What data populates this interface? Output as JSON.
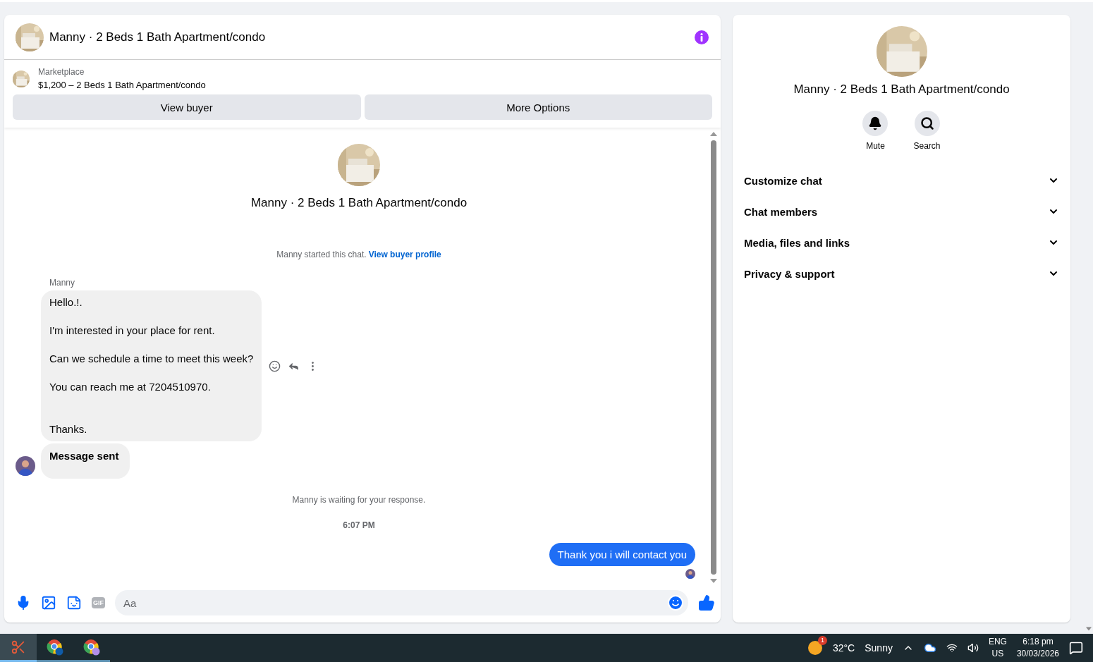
{
  "chat": {
    "title": "Manny · 2 Beds 1 Bath Apartment/condo",
    "listing": {
      "source": "Marketplace",
      "summary": "$1,200 – 2 Beds 1 Bath Apartment/condo"
    },
    "actions": [
      "View buyer",
      "More Options"
    ],
    "intro": {
      "name": "Manny · 2 Beds 1 Bath Apartment/condo"
    },
    "timeline": [
      {
        "kind": "system",
        "text": "Manny started this chat.",
        "link": "View buyer profile"
      },
      {
        "kind": "incoming",
        "sender": "Manny",
        "bubbles": [
          {
            "text": "Hello.!.\n\nI'm interested in your place for rent.\n\nCan we schedule a time to meet this week?\n\nYou can reach me at 7204510970.\n\n\nThanks.",
            "bold": false,
            "show_actions": true
          },
          {
            "text": "Message sent",
            "bold": true,
            "show_actions": false
          }
        ]
      },
      {
        "kind": "system",
        "text": "Manny is waiting for your response."
      },
      {
        "kind": "time",
        "text": "6:07 PM"
      },
      {
        "kind": "outgoing",
        "text": "Thank you i will contact you",
        "seen": true
      }
    ],
    "composer": {
      "placeholder": "Aa",
      "gif_label": "GIF"
    }
  },
  "details": {
    "name": "Manny · 2 Beds 1 Bath Apartment/condo",
    "actions": [
      {
        "kind": "mute",
        "label": "Mute"
      },
      {
        "kind": "search",
        "label": "Search"
      }
    ],
    "sections": [
      {
        "label": "Customize chat",
        "expanded": false
      },
      {
        "label": "Chat members",
        "expanded": false
      },
      {
        "label": "Media, files and links",
        "expanded": false
      },
      {
        "label": "Privacy & support",
        "expanded": false
      }
    ]
  },
  "taskbar": {
    "apps": [
      {
        "kind": "snipping",
        "selected": true
      },
      {
        "kind": "browser-h",
        "selected": false
      },
      {
        "kind": "browser-profile",
        "selected": false
      }
    ],
    "weather": {
      "badge": "1",
      "temperature": "32°C",
      "condition": "Sunny"
    },
    "language": {
      "primary": "ENG",
      "secondary": "US"
    },
    "clock": {
      "time": "6:18 pm",
      "date": "30/03/2026"
    }
  }
}
